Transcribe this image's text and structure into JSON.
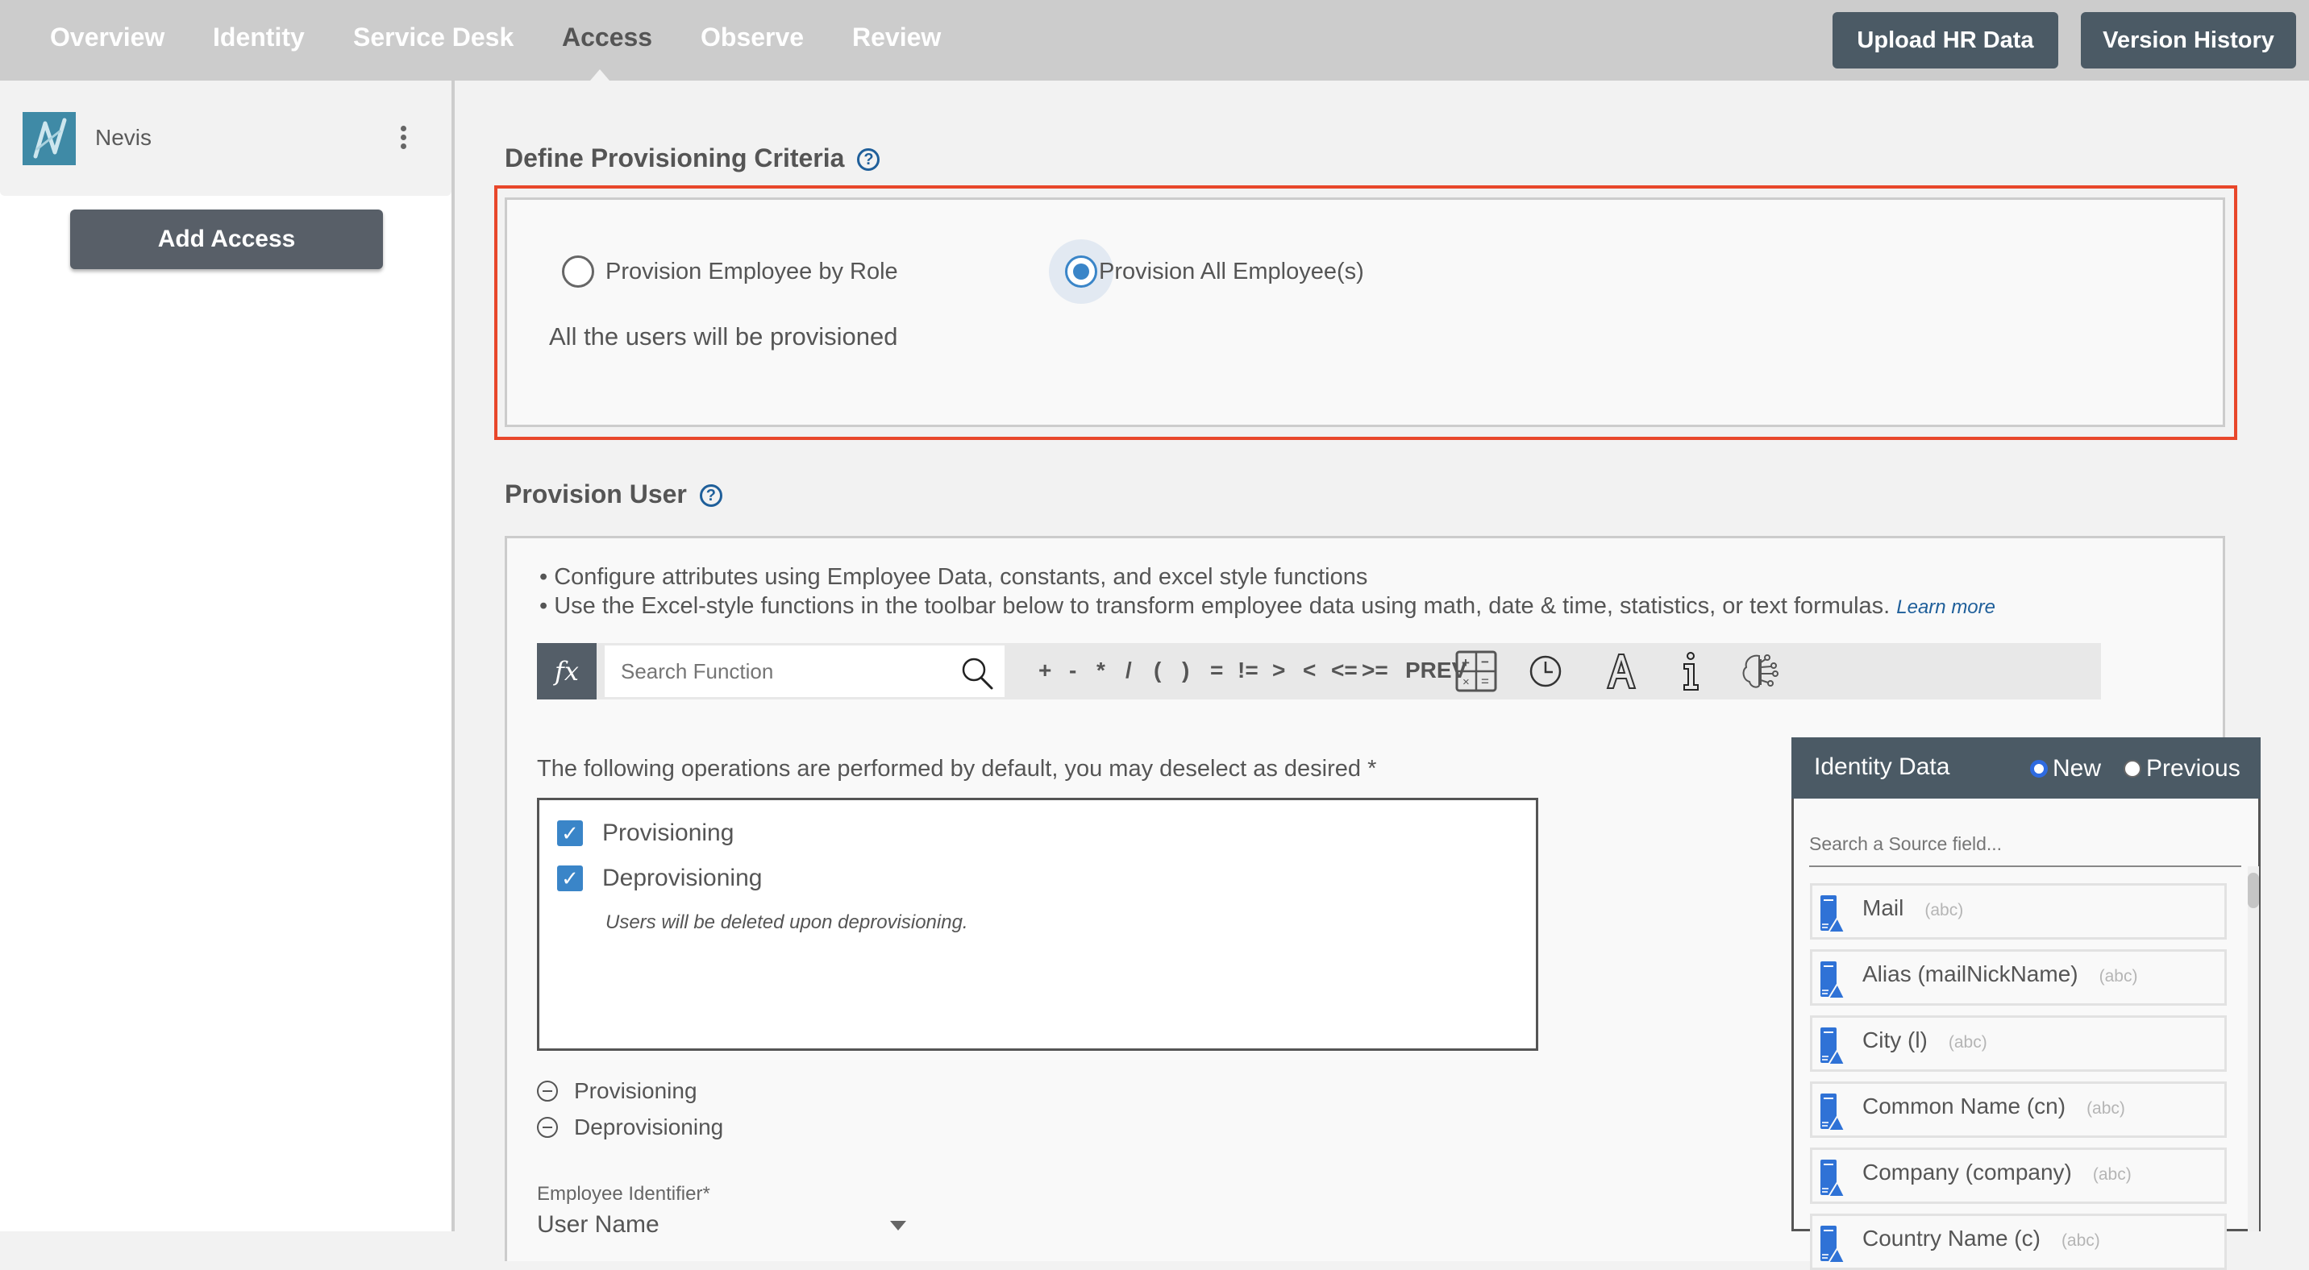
{
  "nav": {
    "tabs": [
      {
        "label": "Overview"
      },
      {
        "label": "Identity"
      },
      {
        "label": "Service Desk"
      },
      {
        "label": "Access",
        "active": true
      },
      {
        "label": "Observe"
      },
      {
        "label": "Review"
      }
    ],
    "buttons": {
      "upload_hr": "Upload HR Data",
      "version_history": "Version History"
    }
  },
  "sidebar": {
    "app_name": "Nevis",
    "add_access": "Add Access"
  },
  "criteria": {
    "title": "Define Provisioning Criteria",
    "help": "?",
    "options": [
      {
        "label": "Provision Employee by Role",
        "selected": false
      },
      {
        "label": "Provision All Employee(s)",
        "selected": true
      }
    ],
    "description": "All the users will be provisioned"
  },
  "provision_user": {
    "title": "Provision User",
    "help": "?",
    "bullets": [
      "Configure attributes using Employee Data, constants, and excel style functions",
      "Use the Excel-style functions in the toolbar below to transform employee data using math, date & time, statistics, or text formulas."
    ],
    "learn_more": "Learn more",
    "toolbar": {
      "fx_label": "fx",
      "search_placeholder": "Search Function",
      "operators": [
        "+",
        "-",
        "*",
        "/",
        "(",
        ")",
        "=",
        "!=",
        ">",
        "<",
        "<=",
        ">=",
        "PREV"
      ],
      "icons": [
        "calculator-icon",
        "clock-icon",
        "text-icon",
        "info-icon",
        "ai-brain-icon"
      ]
    },
    "operations_note": "The following operations are performed by default, you may deselect as desired *",
    "operations": [
      {
        "label": "Provisioning",
        "checked": true
      },
      {
        "label": "Deprovisioning",
        "checked": true
      }
    ],
    "deprovision_note": "Users will be deleted upon deprovisioning.",
    "collapsibles": [
      {
        "label": "Provisioning"
      },
      {
        "label": "Deprovisioning"
      }
    ],
    "employee_identifier": {
      "label": "Employee Identifier*",
      "value": "User Name"
    }
  },
  "identity_data": {
    "title": "Identity Data",
    "mode_new": "New",
    "mode_previous": "Previous",
    "selected_mode": "New",
    "search_placeholder": "Search a Source field...",
    "fields": [
      {
        "name": "Mail",
        "type": "(abc)"
      },
      {
        "name": "Alias (mailNickName)",
        "type": "(abc)"
      },
      {
        "name": "City (l)",
        "type": "(abc)"
      },
      {
        "name": "Common Name (cn)",
        "type": "(abc)"
      },
      {
        "name": "Company (company)",
        "type": "(abc)"
      },
      {
        "name": "Country Name (c)",
        "type": "(abc)"
      }
    ]
  },
  "colors": {
    "nav_bg": "#cccccc",
    "dark_button": "#4b5a65",
    "accent_blue": "#3a85c8",
    "highlight_red": "#e8472b",
    "field_icon_blue": "#2f72d6"
  }
}
